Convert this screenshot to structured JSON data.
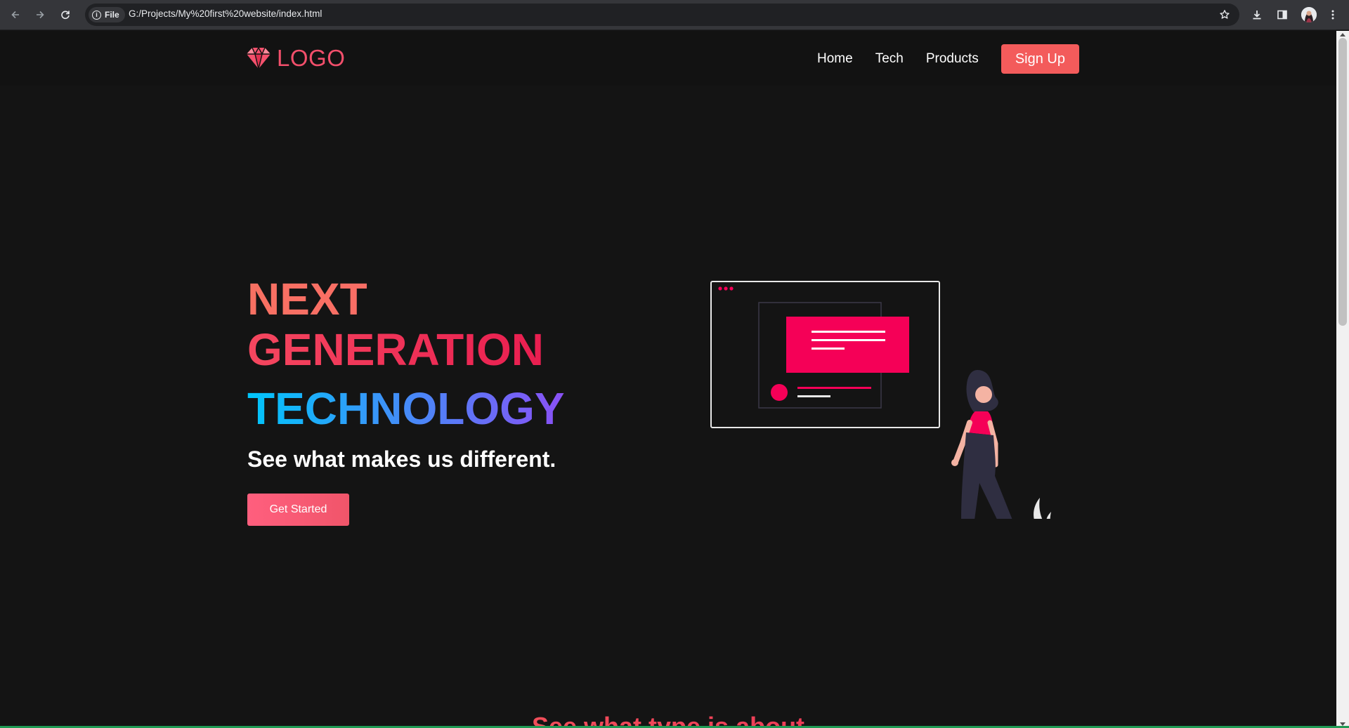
{
  "browser": {
    "file_label": "File",
    "url": "G:/Projects/My%20first%20website/index.html",
    "icons": {
      "back": "arrow-left-icon",
      "forward": "arrow-right-icon",
      "reload": "reload-icon",
      "info": "info-icon",
      "bookmark": "star-icon",
      "downloads": "download-icon",
      "sidepanel": "side-panel-icon",
      "profile": "avatar",
      "menu": "kebab-menu-icon"
    }
  },
  "navbar": {
    "logo_text": "LOGO",
    "logo_icon": "diamond-icon",
    "links": [
      "Home",
      "Tech",
      "Products"
    ],
    "signup_label": "Sign Up"
  },
  "hero": {
    "line1": "NEXT",
    "line2": "GENERATION",
    "line3": "TECHNOLOGY",
    "tagline": "See what makes us different.",
    "cta_label": "Get Started"
  },
  "next_section": {
    "heading": "See what type is about"
  },
  "colors": {
    "background": "#141414",
    "accent": "#f5516d",
    "signup": "#f35b5b",
    "illustration_pink": "#f50057",
    "gradient_blue": "#00c6fb",
    "gradient_purple": "#8a50f5"
  }
}
